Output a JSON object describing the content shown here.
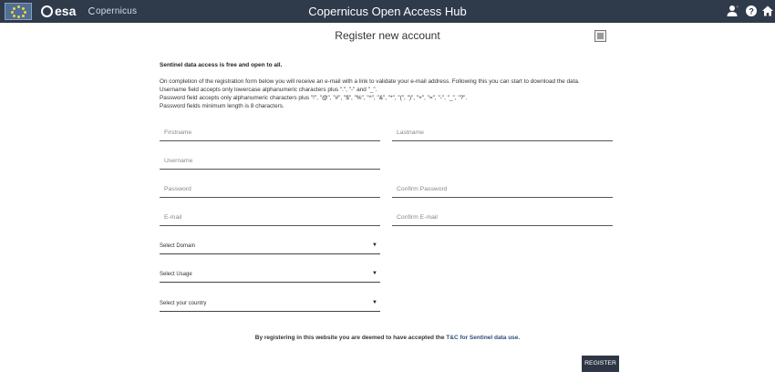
{
  "header": {
    "title": "Copernicus Open Access Hub",
    "esa_logo": "esa",
    "copernicus_logo": "opernicus",
    "icons": [
      "user-icon",
      "help-icon",
      "home-icon"
    ],
    "background": "#2f3a4b"
  },
  "page": {
    "title": "Register new account"
  },
  "intro": {
    "bold_line": "Sentinel data access is free and open to all.",
    "lines": [
      "On completion of the registration form below you will receive an e-mail with a link to validate your e-mail address. Following this you can start to download the data.",
      "Username field accepts only lowercase alphanumeric characters plus \".\", \"-\" and \"_\".",
      "Password field accepts only alphanumeric characters plus \"!\", \"@\", \"#\", \"$\", \"%\", \"^\", \"&\", \"*\", \"(\", \")\", \"+\", \"=\", \"-\", \"_\", \"?\".",
      "Password fields minimum length is 8 characters."
    ]
  },
  "form": {
    "firstname_placeholder": "Firstname",
    "lastname_placeholder": "Lastname",
    "username_placeholder": "Username",
    "password_placeholder": "Password",
    "confirm_password_placeholder": "Confirm Password",
    "email_placeholder": "E-mail",
    "confirm_email_placeholder": "Confirm E-mail",
    "domain_select": "Select Domain",
    "usage_select": "Select Usage",
    "country_select": "Select your country"
  },
  "terms": {
    "text": "By registering in this website you are deemed to have accepted the ",
    "link": "T&C for Sentinel data use."
  },
  "register_label": "REGISTER"
}
